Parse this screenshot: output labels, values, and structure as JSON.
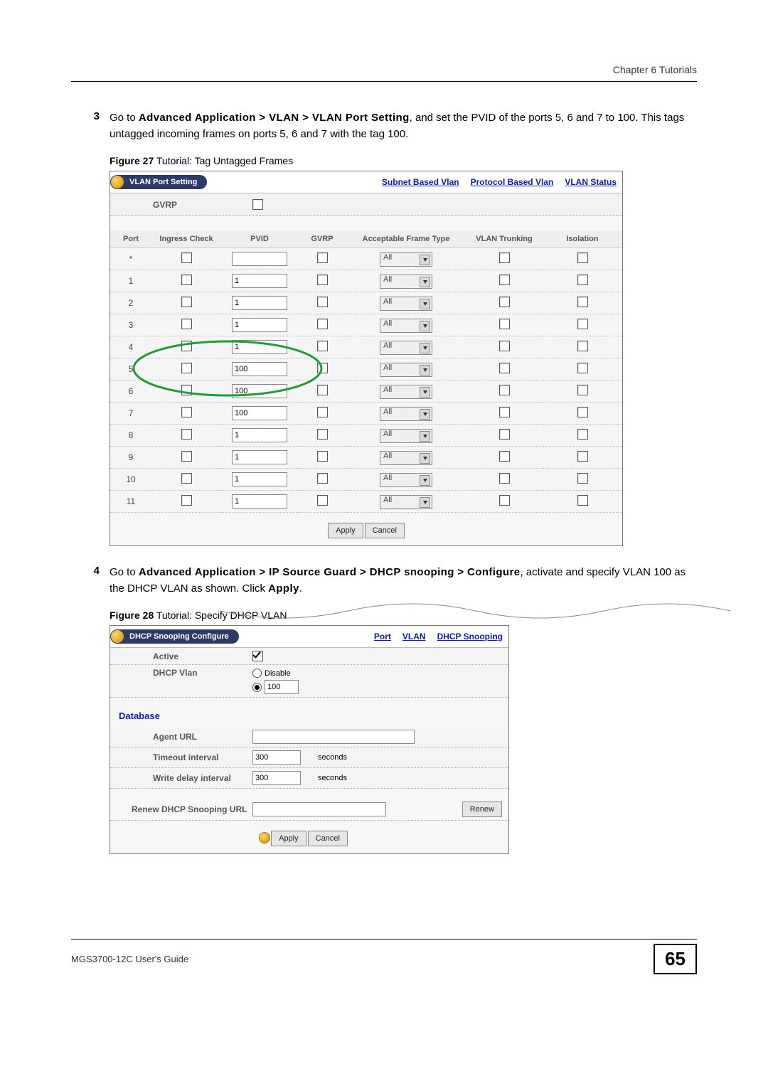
{
  "header": {
    "right": "Chapter 6 Tutorials"
  },
  "steps": {
    "s3": {
      "num": "3",
      "prefix": "Go to ",
      "path": "Advanced Application > VLAN > VLAN Port Setting",
      "suffix": ", and set the PVID of the ports 5, 6 and 7 to 100. This tags untagged incoming frames on ports 5, 6 and 7 with the tag 100."
    },
    "s4": {
      "num": "4",
      "prefix": "Go to ",
      "path": "Advanced Application > IP Source Guard > DHCP snooping > Configure",
      "suffix": ", activate and specify VLAN 100 as the DHCP VLAN as shown. Click ",
      "suffix_bold": "Apply",
      "suffix_end": "."
    }
  },
  "fig27": {
    "caption_b": "Figure 27",
    "caption": "   Tutorial: Tag Untagged Frames",
    "pill": "VLAN Port Setting",
    "links": {
      "l1": "Subnet Based Vlan",
      "l2": "Protocol Based Vlan",
      "l3": "VLAN Status"
    },
    "gvrp_label": "GVRP",
    "th": {
      "port": "Port",
      "ingress": "Ingress Check",
      "pvid": "PVID",
      "gvrp": "GVRP",
      "aft": "Acceptable Frame Type",
      "trunk": "VLAN Trunking",
      "iso": "Isolation"
    },
    "rows": [
      {
        "port": "*",
        "pvid": "",
        "aft": "All"
      },
      {
        "port": "1",
        "pvid": "1",
        "aft": "All"
      },
      {
        "port": "2",
        "pvid": "1",
        "aft": "All"
      },
      {
        "port": "3",
        "pvid": "1",
        "aft": "All"
      },
      {
        "port": "4",
        "pvid": "1",
        "aft": "All"
      },
      {
        "port": "5",
        "pvid": "100",
        "aft": "All"
      },
      {
        "port": "6",
        "pvid": "100",
        "aft": "All"
      },
      {
        "port": "7",
        "pvid": "100",
        "aft": "All"
      },
      {
        "port": "8",
        "pvid": "1",
        "aft": "All"
      },
      {
        "port": "9",
        "pvid": "1",
        "aft": "All"
      },
      {
        "port": "10",
        "pvid": "1",
        "aft": "All"
      },
      {
        "port": "11",
        "pvid": "1",
        "aft": "All"
      }
    ],
    "apply": "Apply",
    "cancel": "Cancel"
  },
  "fig28": {
    "caption_b": "Figure 28",
    "caption": "   Tutorial: Specify DHCP VLAN",
    "pill": "DHCP Snooping Configure",
    "links": {
      "l1": "Port",
      "l2": "VLAN",
      "l3": "DHCP Snooping"
    },
    "active_label": "Active",
    "dhcp_vlan_label": "DHCP Vlan",
    "disable_label": "Disable",
    "dhcp_vlan_value": "100",
    "database_label": "Database",
    "agent_url_label": "Agent URL",
    "agent_url_value": "",
    "timeout_label": "Timeout interval",
    "timeout_value": "300",
    "writedelay_label": "Write delay interval",
    "writedelay_value": "300",
    "seconds": "seconds",
    "renew_label": "Renew DHCP Snooping URL",
    "renew_value": "",
    "renew_btn": "Renew",
    "apply": "Apply",
    "cancel": "Cancel"
  },
  "footer": {
    "left": "MGS3700-12C User's Guide",
    "page": "65"
  }
}
